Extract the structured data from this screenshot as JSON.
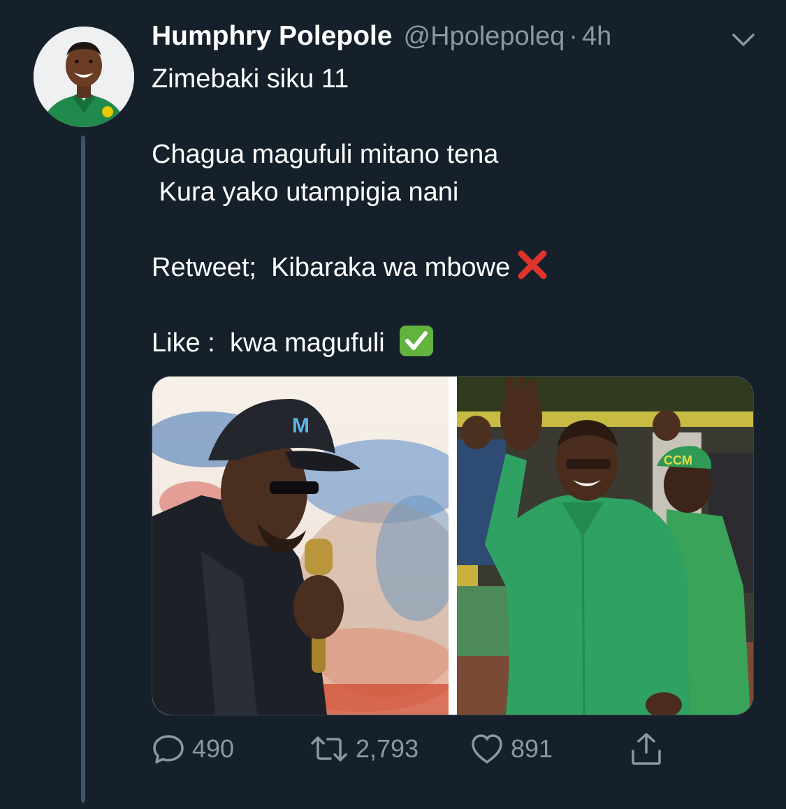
{
  "tweet": {
    "author_name": "Humphry Polepole",
    "author_handle": "@Hpolepoleq",
    "separator": "·",
    "timestamp": "4h",
    "lines": [
      "Zimebaki siku 11",
      "",
      "Chagua magufuli mitano tena",
      " Kura yako utampigia nani",
      "",
      "Retweet;  Kibaraka wa mbowe",
      "",
      "Like :  kwa magufuli"
    ]
  },
  "media": {
    "left_photo_cap_text": "M",
    "right_photo_cap_text": "CCM"
  },
  "actions": {
    "reply_count": "490",
    "retweet_count": "2,793",
    "like_count": "891"
  },
  "icons": {
    "menu": "chevron-down-icon",
    "reply": "reply-icon",
    "retweet": "retweet-icon",
    "like": "heart-icon",
    "share": "share-icon",
    "cross_emoji": "cross-mark-emoji",
    "check_emoji": "check-mark-emoji"
  },
  "colors": {
    "background": "#15202b",
    "secondary_text": "#8899a6",
    "thread_line": "#3d5466",
    "cross_red": "#e0332b",
    "check_green": "#62b33e"
  }
}
